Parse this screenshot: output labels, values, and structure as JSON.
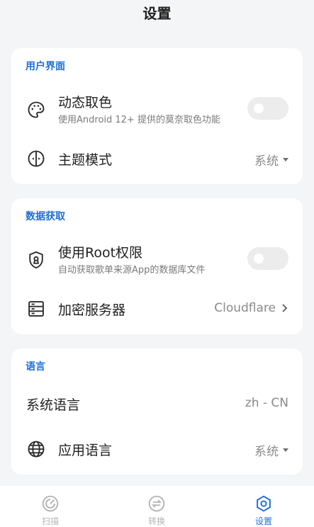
{
  "header": {
    "title": "设置"
  },
  "sections": {
    "ui": {
      "heading": "用户界面",
      "dynamic_color": {
        "title": "动态取色",
        "subtitle": "使用Android 12+ 提供的莫奈取色功能",
        "enabled": false
      },
      "theme_mode": {
        "title": "主题模式",
        "value": "系统"
      }
    },
    "data": {
      "heading": "数据获取",
      "root": {
        "title": "使用Root权限",
        "subtitle": "自动获取歌单来源App的数据库文件",
        "enabled": false
      },
      "encrypt_server": {
        "title": "加密服务器",
        "value": "Cloudflare"
      }
    },
    "language": {
      "heading": "语言",
      "system_language": {
        "title": "系统语言",
        "value": "zh - CN"
      },
      "app_language": {
        "title": "应用语言",
        "value": "系统"
      }
    }
  },
  "nav": {
    "items": [
      {
        "label": "扫描",
        "icon": "scan-icon",
        "active": false
      },
      {
        "label": "转换",
        "icon": "convert-icon",
        "active": false
      },
      {
        "label": "设置",
        "icon": "settings-hex-icon",
        "active": true
      }
    ]
  },
  "colors": {
    "accent": "#1e6fd9",
    "inactive": "#b4b4b4",
    "background": "#f4f5f7",
    "card": "#ffffff"
  }
}
